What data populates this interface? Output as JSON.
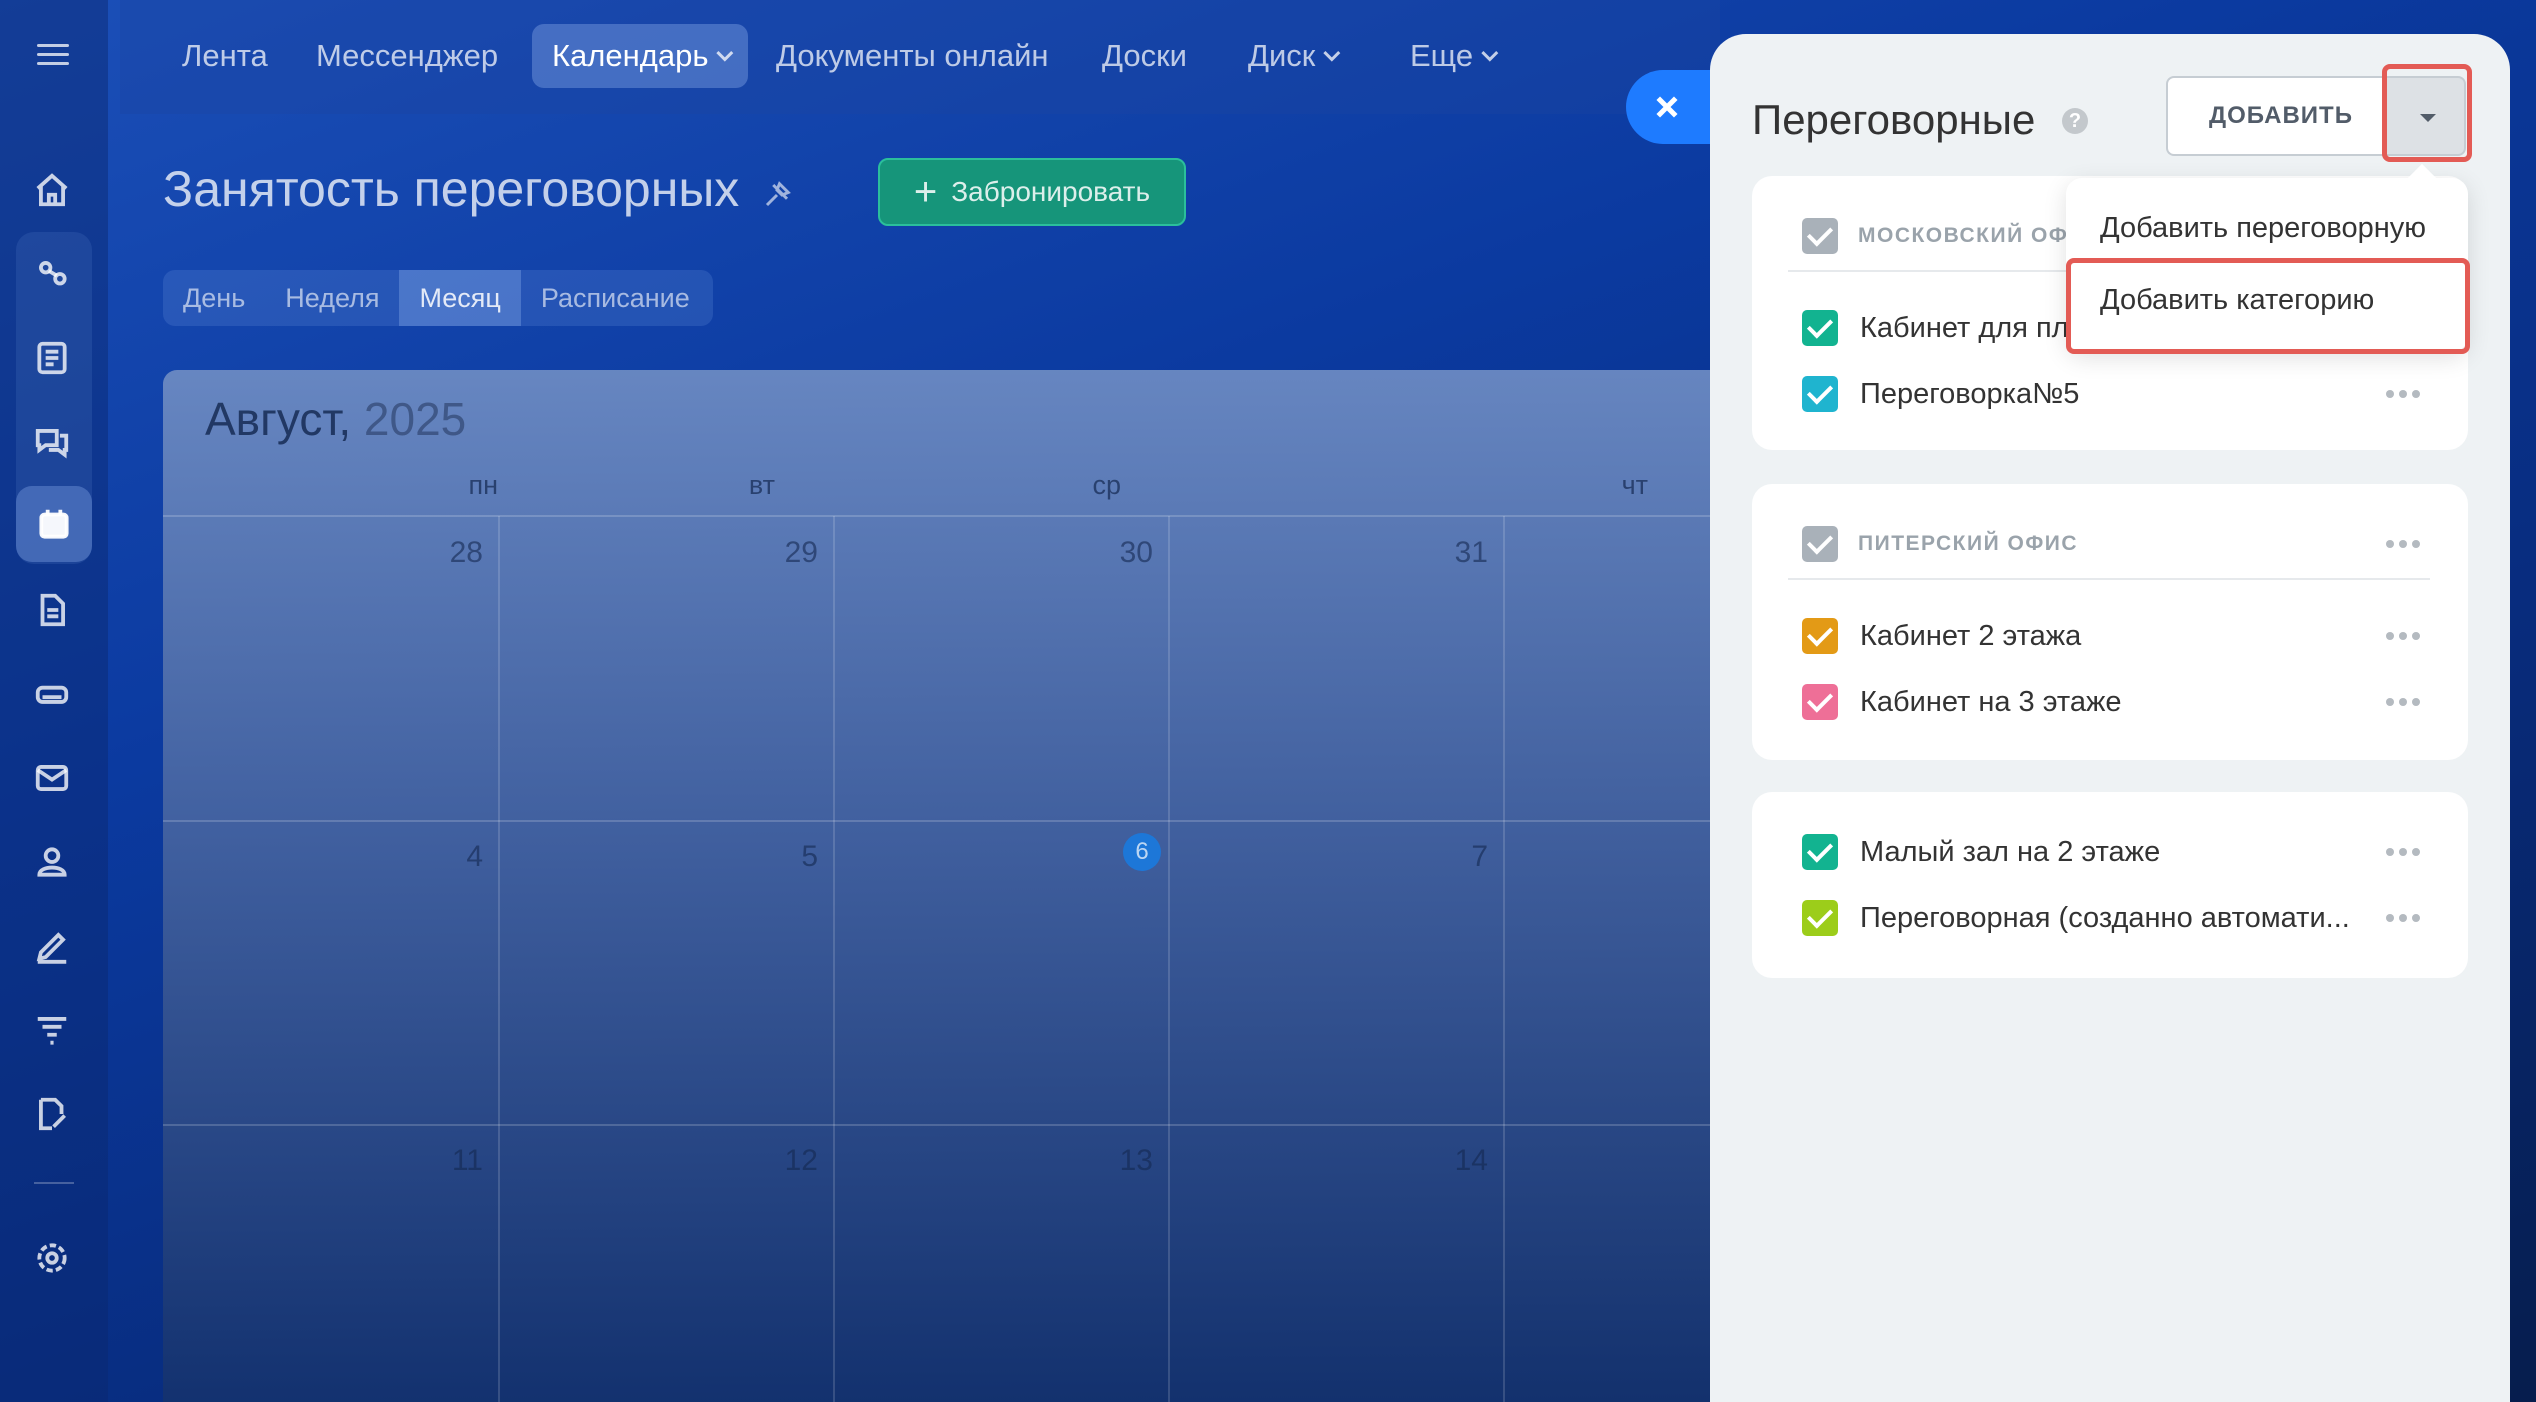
{
  "nav": {
    "items": [
      {
        "label": "Лента"
      },
      {
        "label": "Мессенджер"
      },
      {
        "label": "Календарь"
      },
      {
        "label": "Документы онлайн"
      },
      {
        "label": "Доски"
      },
      {
        "label": "Диск"
      },
      {
        "label": "Еще"
      }
    ]
  },
  "page": {
    "title": "Занятость переговорных",
    "book_button": "Забронировать",
    "view_tabs": [
      "День",
      "Неделя",
      "Месяц",
      "Расписание"
    ],
    "active_tab": "Месяц"
  },
  "calendar": {
    "month": "Август,",
    "year": "2025",
    "weekdays": [
      "пн",
      "вт",
      "ср",
      "чт"
    ],
    "weeks": [
      [
        "28",
        "29",
        "30",
        "31"
      ],
      [
        "4",
        "5",
        "6",
        "7"
      ],
      [
        "11",
        "12",
        "13",
        "14"
      ]
    ],
    "today": "6"
  },
  "panel": {
    "title": "Переговорные",
    "add_button": "ДОБАВИТЬ",
    "dropdown": {
      "add_room": "Добавить переговорную",
      "add_category": "Добавить категорию"
    },
    "categories": [
      {
        "label": "МОСКОВСКИЙ ОФИ",
        "rooms": [
          {
            "label": "Кабинет для пл",
            "color": "#12b390"
          },
          {
            "label": "Переговорка№5",
            "color": "#1fb4cf"
          }
        ]
      },
      {
        "label": "ПИТЕРСКИЙ ОФИС",
        "rooms": [
          {
            "label": "Кабинет 2 этажа",
            "color": "#e39a16"
          },
          {
            "label": "Кабинет на 3 этаже",
            "color": "#ee6f97"
          }
        ]
      },
      {
        "label": "",
        "rooms": [
          {
            "label": "Малый зал на 2 этаже",
            "color": "#12b390"
          },
          {
            "label": "Переговорная (созданно автомати...",
            "color": "#9ccd1a"
          }
        ]
      }
    ]
  },
  "colors": {
    "category_check": "#a9b1b9",
    "highlight": "#e35b55",
    "book_button": "#16957a",
    "close_button": "#1e7bff"
  }
}
